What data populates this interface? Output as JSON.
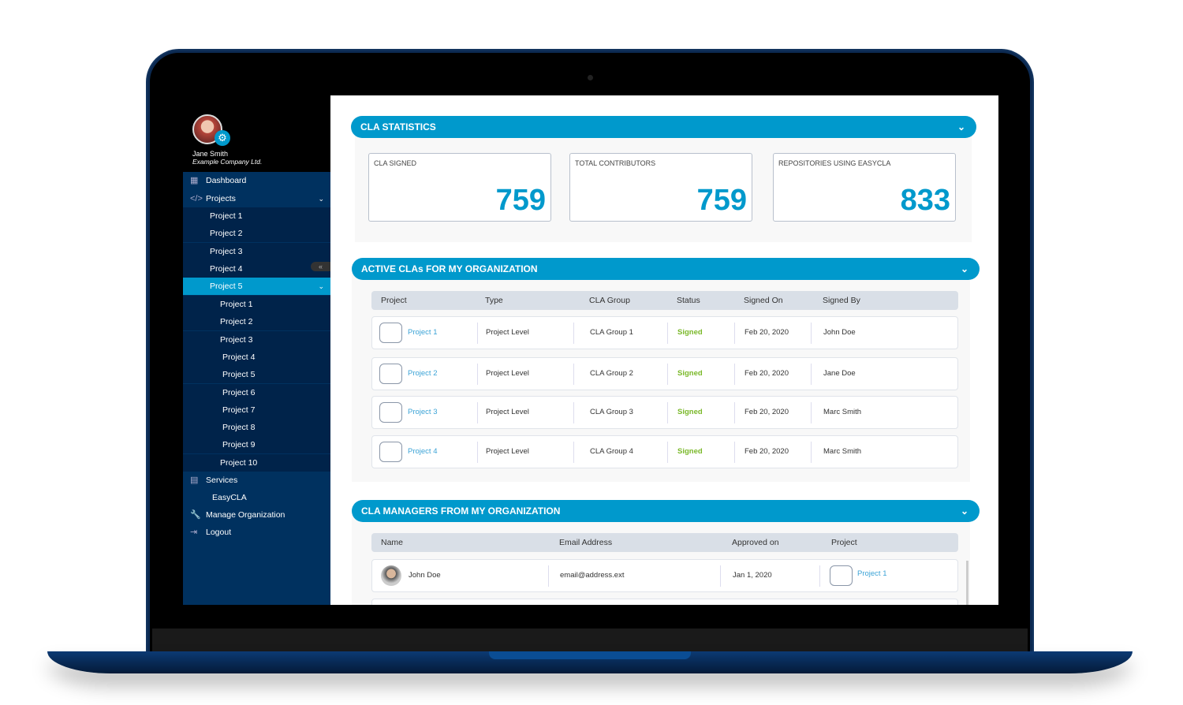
{
  "user": {
    "name": "Jane Smith",
    "company": "Example Company Ltd."
  },
  "sidebar": {
    "dashboard": "Dashboard",
    "projects": "Projects",
    "projects_list": [
      "Project 1",
      "Project 2",
      "Project 3",
      "Project 4",
      "Project 5"
    ],
    "sub_projects": [
      "Project 1",
      "Project 2",
      "Project 3",
      "Project 4",
      "Project 5",
      "Project 6",
      "Project 7",
      "Project 8",
      "Project 9",
      "Project 10"
    ],
    "services": "Services",
    "easycla": "EasyCLA",
    "manage": "Manage Organization",
    "logout": "Logout",
    "collapse": "«"
  },
  "stats": {
    "title": "CLA STATISTICS",
    "cards": [
      {
        "label": "CLA SIGNED",
        "value": "759"
      },
      {
        "label": "TOTAL CONTRIBUTORS",
        "value": "759"
      },
      {
        "label": "REPOSITORIES USING EASYCLA",
        "value": "833"
      }
    ]
  },
  "active": {
    "title": "ACTIVE CLAs FOR MY ORGANIZATION",
    "columns": [
      "Project",
      "Type",
      "CLA Group",
      "Status",
      "Signed On",
      "Signed By"
    ],
    "rows": [
      [
        "Project 1",
        "Project Level",
        "CLA Group 1",
        "Signed",
        "Feb 20, 2020",
        "John Doe"
      ],
      [
        "Project 2",
        "Project Level",
        "CLA Group 2",
        "Signed",
        "Feb 20, 2020",
        "Jane Doe"
      ],
      [
        "Project 3",
        "Project Level",
        "CLA Group 3",
        "Signed",
        "Feb 20, 2020",
        "Marc Smith"
      ],
      [
        "Project 4",
        "Project Level",
        "CLA Group 4",
        "Signed",
        "Feb 20, 2020",
        "Marc Smith"
      ]
    ]
  },
  "managers": {
    "title": "CLA MANAGERS FROM MY ORGANIZATION",
    "columns": [
      "Name",
      "Email Address",
      "Approved on",
      "Project"
    ],
    "rows": [
      [
        "John Doe",
        "email@address.ext",
        "Jan 1, 2020",
        "Project 1"
      ]
    ]
  },
  "colors": {
    "accent": "#0099cc",
    "sidebar": "#00315f",
    "signed": "#7ab829"
  }
}
